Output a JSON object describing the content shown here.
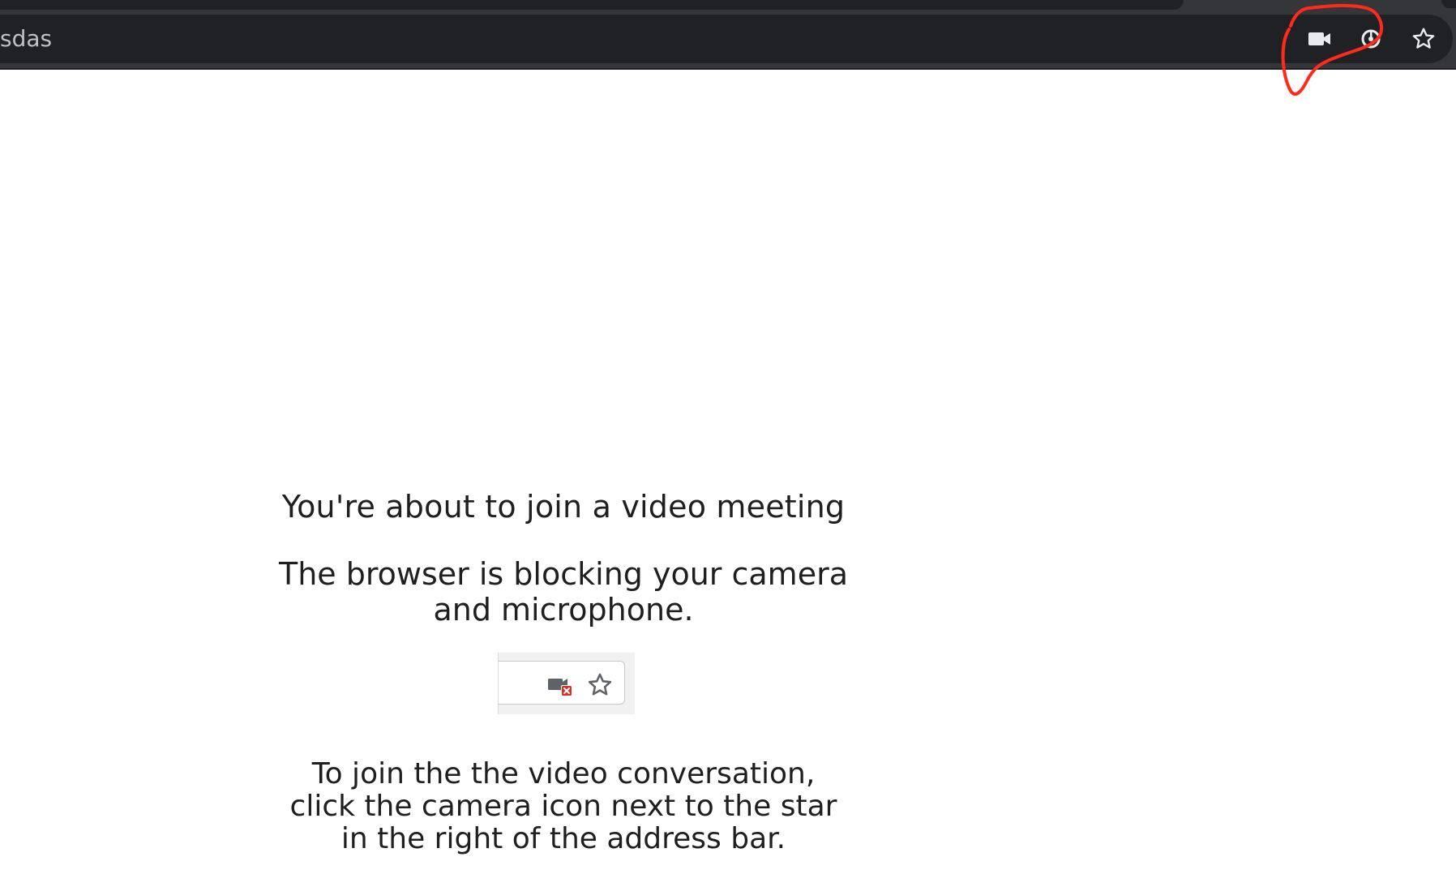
{
  "browser": {
    "address_text": "sdas",
    "icons": {
      "camera": "camera-icon",
      "lens": "lens-icon",
      "bookmark": "star-icon"
    },
    "colors": {
      "chrome_bg": "#35363a",
      "omnibox_bg": "#202124",
      "icon_color": "#e8eaed",
      "annotation": "#ff2a1a"
    }
  },
  "page": {
    "heading": "You're about to join a video meeting",
    "blocked_message": "The browser is blocking your camera and microphone.",
    "instructions": "To join the the video conversation, click the camera icon next to the star in the right of the address bar.",
    "illustration_icons": {
      "camera_blocked": "camera-blocked-icon",
      "star": "star-icon"
    },
    "colors": {
      "text": "#1f1f1f",
      "blocked_badge": "#d93025"
    }
  }
}
